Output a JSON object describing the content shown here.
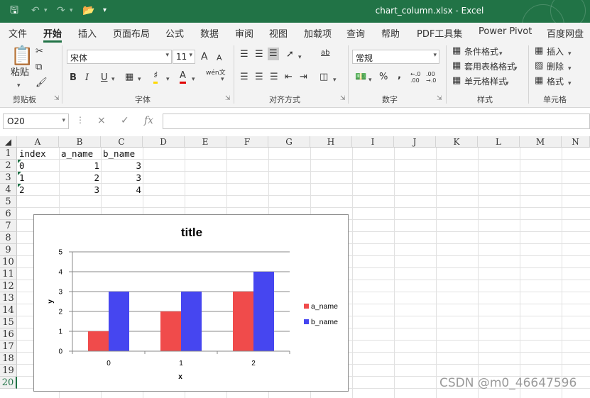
{
  "titlebar": {
    "filename": "chart_column.xlsx",
    "app": "Excel",
    "customize_glyph": "▾"
  },
  "tabs": [
    "文件",
    "开始",
    "插入",
    "页面布局",
    "公式",
    "数据",
    "审阅",
    "视图",
    "加载项",
    "查询",
    "帮助",
    "PDF工具集",
    "Power Pivot",
    "百度网盘"
  ],
  "active_tab": "开始",
  "ribbon": {
    "clipboard": {
      "label": "剪贴板",
      "paste": "粘贴"
    },
    "font": {
      "label": "字体",
      "font_name": "宋体",
      "font_size": "11",
      "grow": "A",
      "shrink": "A",
      "bold": "B",
      "italic": "I",
      "underline": "U",
      "phonetic": "wén文"
    },
    "alignment": {
      "label": "对齐方式",
      "wrap": "ab"
    },
    "number": {
      "label": "数字",
      "format": "常规",
      "percent": "%",
      "comma": ","
    },
    "styles": {
      "label": "样式",
      "conditional": "条件格式",
      "table": "套用表格格式",
      "cell_styles": "单元格样式"
    },
    "cells": {
      "label": "单元格",
      "insert": "插入",
      "delete": "删除",
      "format": "格式"
    }
  },
  "formula_bar": {
    "name_box": "O20",
    "cancel": "×",
    "enter": "✓",
    "fx": "fx",
    "formula": ""
  },
  "columns": [
    "A",
    "B",
    "C",
    "D",
    "E",
    "F",
    "G",
    "H",
    "I",
    "J",
    "K",
    "L",
    "M",
    "N"
  ],
  "rows": [
    "1",
    "2",
    "3",
    "4",
    "5",
    "6",
    "7",
    "8",
    "9",
    "10",
    "11",
    "12",
    "13",
    "14",
    "15",
    "16",
    "17",
    "18",
    "19",
    "20"
  ],
  "selected_row": "20",
  "sheet": {
    "header": [
      "index",
      "a_name",
      "b_name"
    ],
    "data": [
      [
        "0",
        "1",
        "3"
      ],
      [
        "1",
        "2",
        "3"
      ],
      [
        "2",
        "3",
        "4"
      ]
    ]
  },
  "chart_data": {
    "type": "bar",
    "title": "title",
    "xlabel": "x",
    "ylabel": "y",
    "categories": [
      "0",
      "1",
      "2"
    ],
    "series": [
      {
        "name": "a_name",
        "values": [
          1,
          2,
          3
        ],
        "color": "#f04b4b"
      },
      {
        "name": "b_name",
        "values": [
          3,
          3,
          4
        ],
        "color": "#4646f0"
      }
    ],
    "ylim": [
      0,
      5
    ],
    "yticks": [
      0,
      1,
      2,
      3,
      4,
      5
    ],
    "grid": true,
    "legend": "right"
  },
  "watermark": "CSDN @m0_46647596",
  "colors": {
    "accent": "#217346"
  }
}
